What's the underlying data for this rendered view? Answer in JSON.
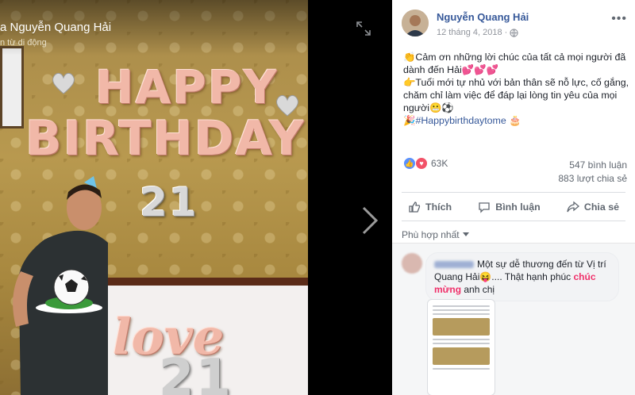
{
  "photo": {
    "owner_name": "a Nguyễn Quang Hải",
    "caption": "n từ di động",
    "balloon_happy": "HAPPY",
    "balloon_birthday": "BIRTHDAY",
    "balloon_age": "21",
    "balloon_love": "love",
    "balloon_bottom": "21"
  },
  "viewer": {
    "expand_icon": "expand-icon",
    "next_icon": "chevron-right-icon"
  },
  "post": {
    "author": "Nguyễn Quang Hải",
    "date": "12 tháng 4, 2018",
    "privacy_icon": "globe-icon",
    "line1": "👏Cảm ơn những lời chúc của tất cả mọi người đã dành đến Hải💕💕💕",
    "line2": "👉Tuổi mới tự nhủ với bản thân sẽ nỗ lực, cố gắng, chăm chỉ làm việc để đáp lại lòng tin yêu của mọi người😬⚽",
    "line3_prefix": "🎉",
    "hashtag": "#Happybirthdaytome",
    "line3_suffix": "🎂"
  },
  "reactions": {
    "count": "63K",
    "comments": "547 bình luận",
    "shares": "883 lượt chia sẻ"
  },
  "actions": {
    "like": "Thích",
    "comment": "Bình luận",
    "share": "Chia sẻ"
  },
  "comments": {
    "sort_label": "Phù hợp nhất",
    "first": {
      "text_a": "Một sự dễ thương đến từ Vị trí Quang Hải😝.... Thật hạnh phúc ",
      "highlight": "chúc mừng",
      "text_b": " anh chị"
    }
  },
  "colors": {
    "link": "#365899",
    "panel_bg": "#ffffff",
    "highlight": "#f0306a"
  }
}
